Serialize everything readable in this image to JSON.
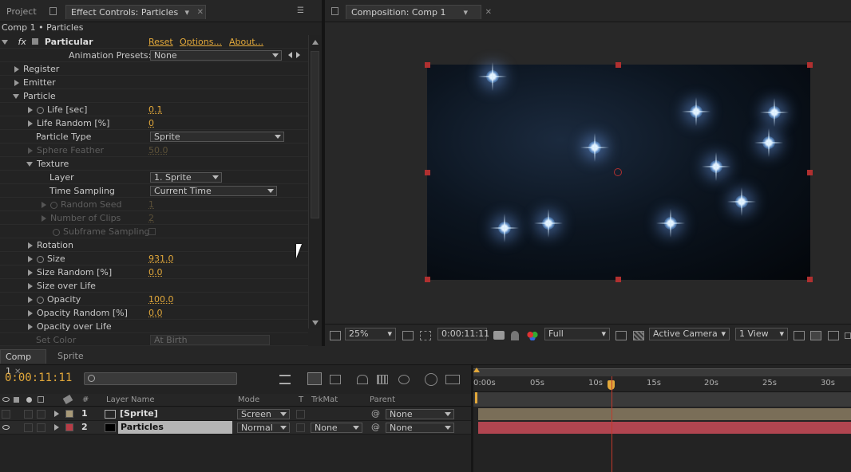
{
  "left_panel": {
    "tabs": [
      {
        "label": "Project"
      },
      {
        "label": "Effect Controls: Particles"
      }
    ],
    "breadcrumb": "Comp 1 • Particles",
    "effect": {
      "fx": "fx",
      "name": "Particular",
      "reset": "Reset",
      "options": "Options...",
      "about": "About..."
    },
    "presets": {
      "label": "Animation Presets:",
      "value": "None"
    },
    "rows": [
      {
        "label": "Register"
      },
      {
        "label": "Emitter"
      },
      {
        "label": "Particle"
      },
      {
        "label": "Life [sec]",
        "value": "0.1"
      },
      {
        "label": "Life Random [%]",
        "value": "0"
      },
      {
        "label": "Particle Type",
        "value": "Sprite"
      },
      {
        "label": "Sphere Feather",
        "value": "50.0"
      },
      {
        "label": "Texture"
      },
      {
        "label": "Layer",
        "value": "1. Sprite"
      },
      {
        "label": "Time Sampling",
        "value": "Current Time"
      },
      {
        "label": "Random Seed",
        "value": "1"
      },
      {
        "label": "Number of Clips",
        "value": "2"
      },
      {
        "label": "Subframe Sampling"
      },
      {
        "label": "Rotation"
      },
      {
        "label": "Size",
        "value": "931.0"
      },
      {
        "label": "Size Random [%]",
        "value": "0.0"
      },
      {
        "label": "Size over Life"
      },
      {
        "label": "Opacity",
        "value": "100.0"
      },
      {
        "label": "Opacity Random [%]",
        "value": "0.0"
      },
      {
        "label": "Opacity over Life"
      },
      {
        "label": "Set Color",
        "value": "At Birth"
      }
    ]
  },
  "comp_panel": {
    "tab": "Composition: Comp 1",
    "zoom": "25%",
    "timecode": "0:00:11:11",
    "resolution": "Full",
    "camera": "Active Camera",
    "views": "1 View"
  },
  "timeline": {
    "tabs": [
      {
        "label": "Comp 1"
      },
      {
        "label": "Sprite"
      }
    ],
    "timecode": "0:00:11:11",
    "search_placeholder": "",
    "columns": {
      "num": "#",
      "name": "Layer Name",
      "mode": "Mode",
      "t": "T",
      "trkmat": "TrkMat",
      "parent": "Parent"
    },
    "layers": [
      {
        "num": "1",
        "name": "[Sprite]",
        "mode": "Screen",
        "trkmat": "",
        "parent": "None",
        "color": "#a89a78"
      },
      {
        "num": "2",
        "name": "Particles",
        "mode": "Normal",
        "trkmat": "None",
        "parent": "None",
        "color": "#b83b45"
      }
    ],
    "ruler": [
      "0:00s",
      "05s",
      "10s",
      "15s",
      "20s",
      "25s",
      "30s"
    ]
  },
  "colors": {
    "accent": "#e2a83a",
    "playhead": "#e2a83a",
    "layer1_bar": "#7a6e58",
    "layer2_bar": "#b14550"
  }
}
